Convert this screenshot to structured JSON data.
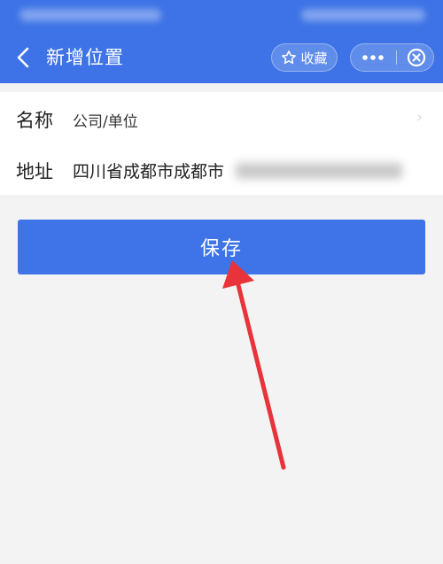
{
  "nav": {
    "title": "新增位置",
    "favorite_label": "收藏"
  },
  "form": {
    "name_label": "名称",
    "name_value": "公司/单位",
    "address_label": "地址",
    "address_value": "四川省成都市成都市"
  },
  "save_label": "保存",
  "colors": {
    "nav_blue": "#3d73e6",
    "button_blue": "#3e74e8",
    "annotation_red": "#e8333a",
    "page_bg": "#f3f3f3"
  },
  "icons": [
    "back-chevron-icon",
    "star-icon",
    "more-dots-icon",
    "close-circle-icon",
    "chevron-right-icon"
  ]
}
